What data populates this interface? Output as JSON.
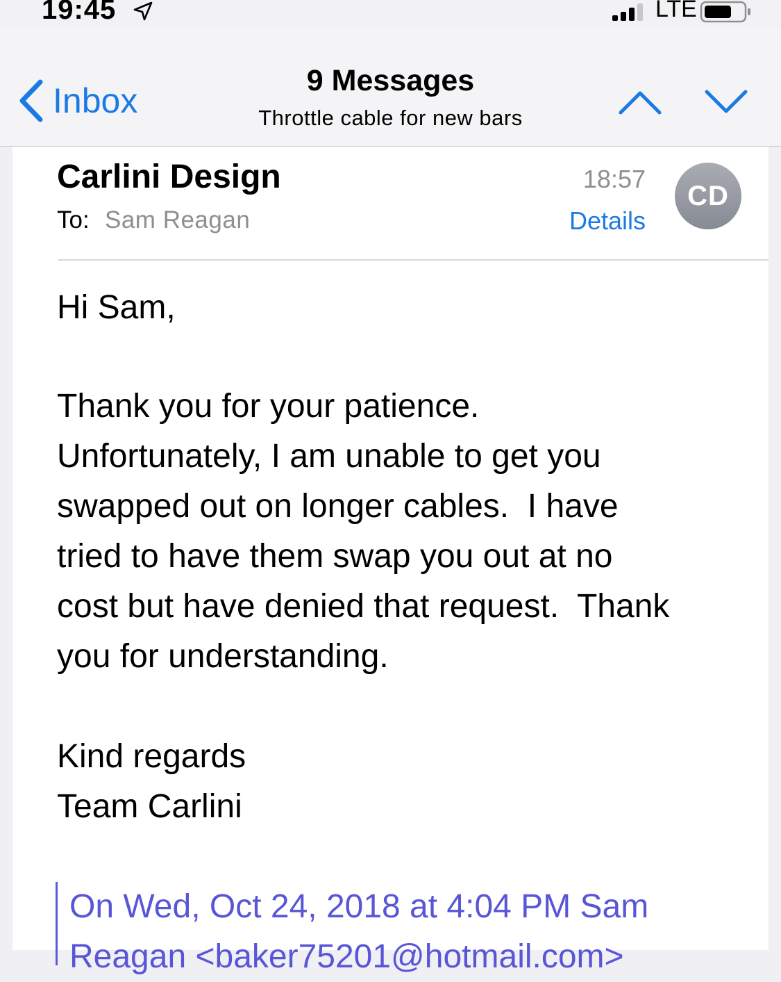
{
  "status_bar": {
    "time": "19:45",
    "network": "LTE"
  },
  "nav": {
    "back_label": "Inbox",
    "title": "9 Messages",
    "subtitle": "Throttle cable for new bars"
  },
  "message": {
    "sender": "Carlini Design",
    "to_label": "To:",
    "recipient": "Sam Reagan",
    "time": "18:57",
    "details_label": "Details",
    "avatar_initials": "CD",
    "greeting": "Hi Sam,",
    "body_lines": "Thank you for your patience.\nUnfortunately, I am unable to get you\nswapped out on longer cables.  I have\ntried to have them swap you out at no\ncost but have denied that request.  Thank\nyou for understanding.",
    "signoff": "Kind regards\nTeam Carlini",
    "quote_header": "On Wed, Oct 24, 2018 at 4:04 PM Sam",
    "quote_header_cont": "Reagan <baker75201@hotmail.com>"
  },
  "colors": {
    "accent_blue": "#1c7ae4",
    "quote_purple": "#5856d6",
    "secondary_gray": "#8e8e93"
  }
}
